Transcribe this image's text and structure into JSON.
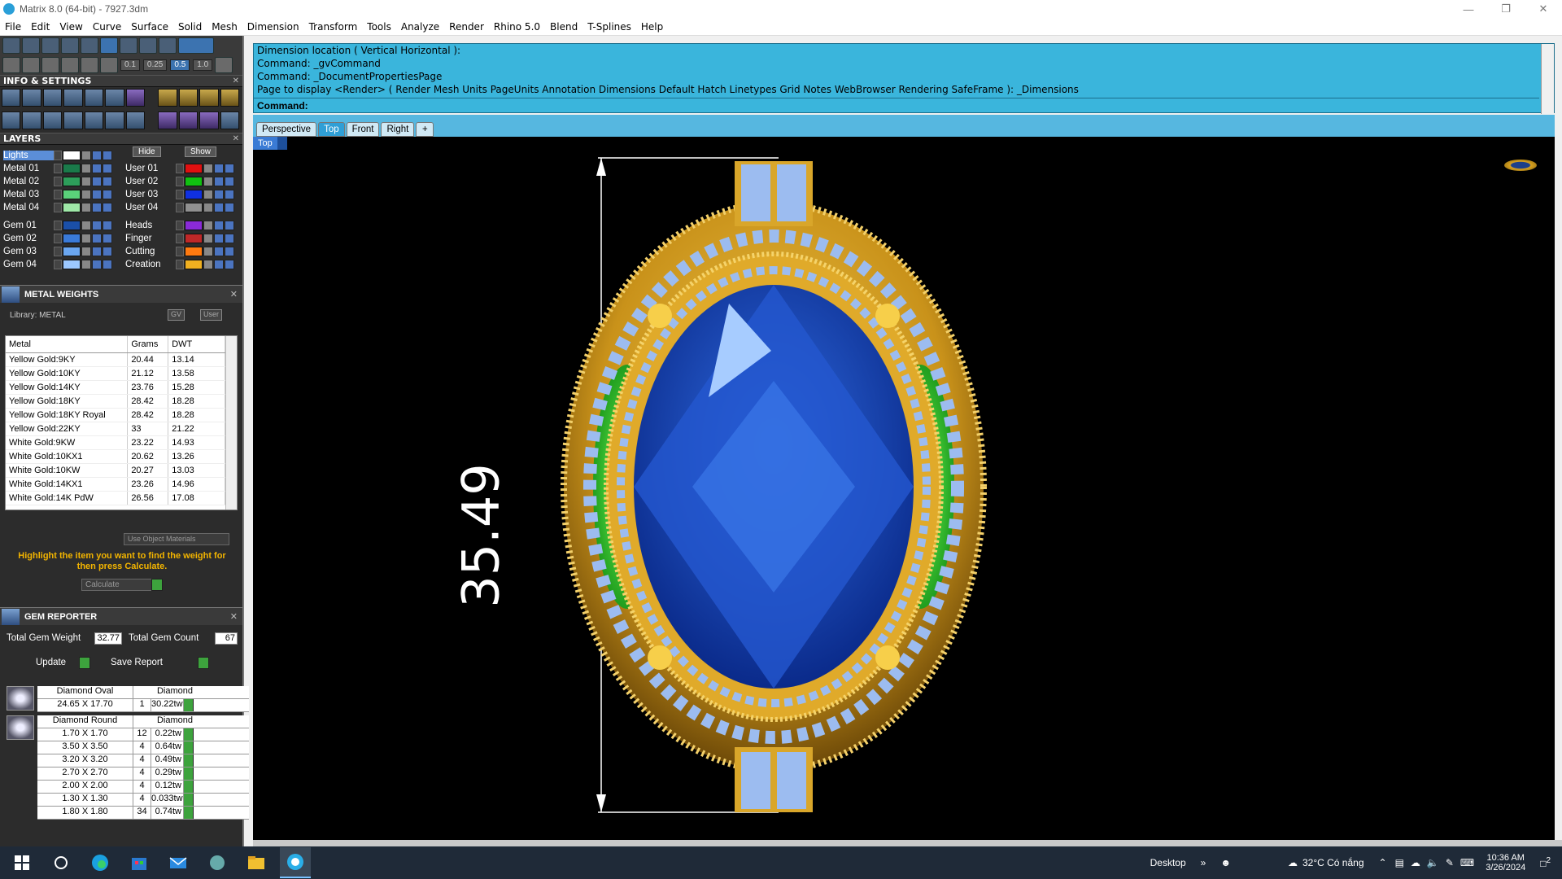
{
  "window": {
    "title": "Matrix 8.0 (64-bit) - 7927.3dm"
  },
  "menu": [
    "File",
    "Edit",
    "View",
    "Curve",
    "Surface",
    "Solid",
    "Mesh",
    "Dimension",
    "Transform",
    "Tools",
    "Analyze",
    "Render",
    "Rhino 5.0",
    "Blend",
    "T-Splines",
    "Help"
  ],
  "toolbar": {
    "zoom_values": [
      "0.1",
      "0.25",
      "0.5",
      "1.0"
    ]
  },
  "panels": {
    "info_settings": "INFO & SETTINGS",
    "layers": "LAYERS",
    "metal_weights": "METAL WEIGHTS",
    "gem_reporter": "GEM REPORTER"
  },
  "layers": {
    "hide_label": "Hide",
    "show_label": "Show",
    "left": [
      {
        "name": "Lights",
        "color": "#ffffff"
      },
      {
        "name": "Metal 01",
        "color": "#1a7a4a"
      },
      {
        "name": "Metal 02",
        "color": "#2d9e5a"
      },
      {
        "name": "Metal 03",
        "color": "#5ad17a"
      },
      {
        "name": "Metal 04",
        "color": "#9fe8a8"
      },
      {
        "name": "Gem 01",
        "color": "#1a4fa8"
      },
      {
        "name": "Gem 02",
        "color": "#3a7ad8"
      },
      {
        "name": "Gem 03",
        "color": "#6aa6f0"
      },
      {
        "name": "Gem 04",
        "color": "#9cc8ff"
      }
    ],
    "right": [
      {
        "name": "User 01",
        "color": "#e01010"
      },
      {
        "name": "User 02",
        "color": "#10c010"
      },
      {
        "name": "User 03",
        "color": "#1030e0"
      },
      {
        "name": "User 04",
        "color": "#909090"
      },
      {
        "name": "Heads",
        "color": "#8a2ad8"
      },
      {
        "name": "Finger",
        "color": "#c02828"
      },
      {
        "name": "Cutting",
        "color": "#ff7a10"
      },
      {
        "name": "Creation",
        "color": "#f0b020"
      }
    ]
  },
  "metal_weights": {
    "library_label": "Library: METAL",
    "gv_label": "GV",
    "user_label": "User",
    "headers": [
      "Metal",
      "Grams",
      "DWT"
    ],
    "rows": [
      [
        "Yellow Gold:9KY",
        "20.44",
        "13.14"
      ],
      [
        "Yellow Gold:10KY",
        "21.12",
        "13.58"
      ],
      [
        "Yellow Gold:14KY",
        "23.76",
        "15.28"
      ],
      [
        "Yellow Gold:18KY",
        "28.42",
        "18.28"
      ],
      [
        "Yellow Gold:18KY Royal",
        "28.42",
        "18.28"
      ],
      [
        "Yellow Gold:22KY",
        "33",
        "21.22"
      ],
      [
        "White Gold:9KW",
        "23.22",
        "14.93"
      ],
      [
        "White Gold:10KX1",
        "20.62",
        "13.26"
      ],
      [
        "White Gold:10KW",
        "20.27",
        "13.03"
      ],
      [
        "White Gold:14KX1",
        "23.26",
        "14.96"
      ],
      [
        "White Gold:14K PdW",
        "26.56",
        "17.08"
      ]
    ],
    "use_object_materials": "Use Object Materials",
    "hint": "Highlight the item you want to find the weight for then press Calculate.",
    "calculate_label": "Calculate"
  },
  "gem_reporter": {
    "total_weight_label": "Total Gem Weight",
    "total_weight_value": "32.77",
    "total_count_label": "Total Gem Count",
    "total_count_value": "67",
    "update_label": "Update",
    "save_report_label": "Save Report",
    "oval": {
      "header": [
        "Diamond Oval",
        "Diamond"
      ],
      "row": [
        "24.65 X 17.70",
        "1",
        "30.22tw"
      ]
    },
    "round": {
      "header": [
        "Diamond Round",
        "Diamond"
      ],
      "rows": [
        [
          "1.70 X 1.70",
          "12",
          "0.22tw"
        ],
        [
          "3.50 X 3.50",
          "4",
          "0.64tw"
        ],
        [
          "3.20 X 3.20",
          "4",
          "0.49tw"
        ],
        [
          "2.70 X 2.70",
          "4",
          "0.29tw"
        ],
        [
          "2.00 X 2.00",
          "4",
          "0.12tw"
        ],
        [
          "1.30 X 1.30",
          "4",
          "0.033tw"
        ],
        [
          "1.80 X 1.80",
          "34",
          "0.74tw"
        ]
      ]
    }
  },
  "command_history": [
    "Dimension location ( Vertical  Horizontal ):",
    "Command: _gvCommand",
    "Command: _DocumentPropertiesPage",
    "Page to display <Render> ( Render  Mesh  Units  PageUnits  Annotation  Dimensions  Default  Hatch  Linetypes  Grid  Notes  WebBrowser  Rendering  SafeFrame ): _Dimensions"
  ],
  "command_prompt": "Command:",
  "viewport_tabs": [
    "Perspective",
    "Top",
    "Front",
    "Right"
  ],
  "active_viewport_tab": "Top",
  "viewport_label": "Top",
  "dimension_value": "35.49",
  "taskbar": {
    "desktop_label": "Desktop",
    "weather": "32°C  Có nắng",
    "time": "10:36 AM",
    "date": "3/26/2024",
    "notifications": "2"
  }
}
